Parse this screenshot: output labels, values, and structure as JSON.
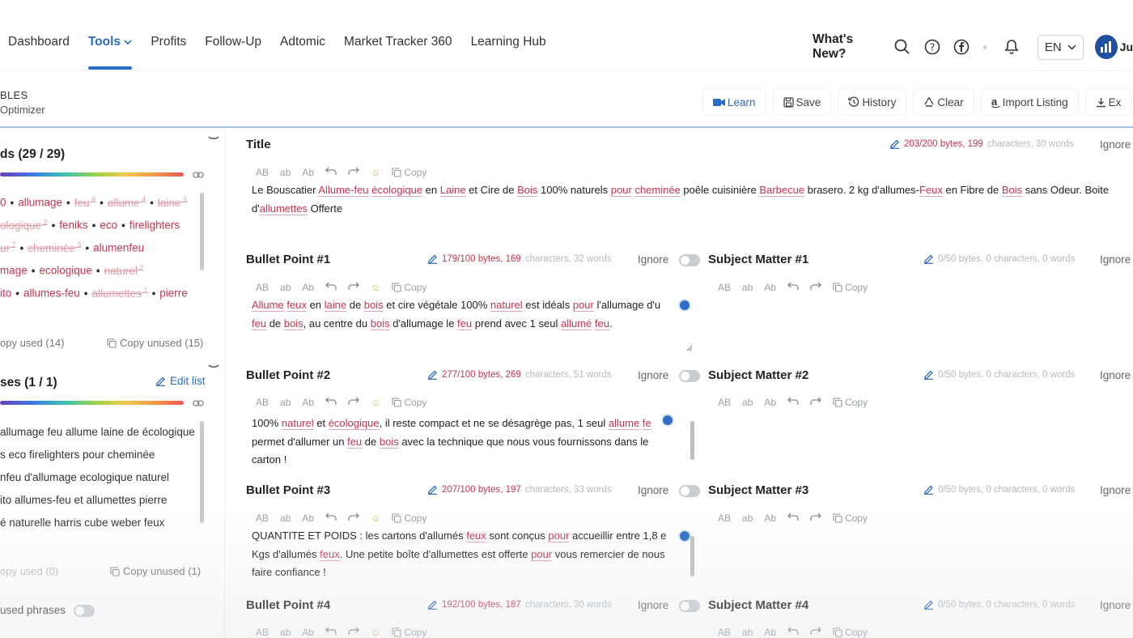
{
  "nav": {
    "links": [
      "Dashboard",
      "Tools",
      "Profits",
      "Follow-Up",
      "Adtomic",
      "Market Tracker 360",
      "Learning Hub"
    ],
    "active": "Tools",
    "whats_new": "What's New?",
    "language": "EN",
    "user_initials": "Ju"
  },
  "breadcrumb": {
    "line1": "BLES",
    "line2": "Optimizer"
  },
  "toolbar": {
    "learn": "Learn",
    "save": "Save",
    "history": "History",
    "clear": "Clear",
    "import": "Import Listing",
    "export": "Ex"
  },
  "keywords": {
    "title": "ds (29 / 29)",
    "lines": [
      [
        {
          "t": "0",
          "s": false,
          "sup": ""
        },
        {
          "t": "allumage",
          "s": false,
          "sup": ""
        },
        {
          "t": "feu",
          "s": true,
          "sup": "8"
        },
        {
          "t": "allume",
          "s": true,
          "sup": "4"
        },
        {
          "t": "laine",
          "s": true,
          "sup": "3"
        }
      ],
      [
        {
          "t": "ologique",
          "s": true,
          "sup": "2"
        },
        {
          "t": "feniks",
          "s": false,
          "sup": ""
        },
        {
          "t": "eco",
          "s": false,
          "sup": ""
        },
        {
          "t": "firelighters",
          "s": false,
          "sup": ""
        }
      ],
      [
        {
          "t": "ur",
          "s": true,
          "sup": "7"
        },
        {
          "t": "cheminée",
          "s": true,
          "sup": "3"
        },
        {
          "t": "alumenfeu",
          "s": false,
          "sup": ""
        }
      ],
      [
        {
          "t": "mage",
          "s": false,
          "sup": ""
        },
        {
          "t": "ecologique",
          "s": false,
          "sup": ""
        },
        {
          "t": "naturel",
          "s": true,
          "sup": "2"
        }
      ],
      [
        {
          "t": "ito",
          "s": false,
          "sup": ""
        },
        {
          "t": "allumes-feu",
          "s": false,
          "sup": ""
        },
        {
          "t": "allumettes",
          "s": true,
          "sup": "1"
        },
        {
          "t": "pierre",
          "s": false,
          "sup": ""
        }
      ]
    ],
    "copy_used": "opy used (14)",
    "copy_unused": "Copy unused (15)"
  },
  "phrases": {
    "title": "ses (1 / 1)",
    "edit_list": "Edit list",
    "items": [
      "allumage feu allume laine de écologique",
      "s eco firelighters pour cheminée",
      "nfeu d'allumage ecologique naturel",
      "ito allumes-feu et allumettes pierre",
      "é naturelle harris cube weber feux"
    ],
    "copy_used": "opy used (0)",
    "copy_unused": "Copy unused (1)",
    "unused_label": "used phrases"
  },
  "editor_tools": {
    "ab_upper": "AB",
    "ab_lower": "ab",
    "ab_title": "Ab",
    "copy": "Copy"
  },
  "ignore_label": "Ignore",
  "sections": {
    "title": {
      "name": "Title",
      "bytes": "203/200 bytes, 199",
      "rest": "characters, 30 words",
      "line1": [
        [
          "Le Bouscatier ",
          false
        ],
        [
          "Allume-feu",
          true
        ],
        [
          " ",
          false
        ],
        [
          "écologique",
          true
        ],
        [
          " en ",
          false
        ],
        [
          "Laine",
          true
        ],
        [
          " et Cire de ",
          false
        ],
        [
          "Bois",
          true
        ],
        [
          " 100% naturels ",
          false
        ],
        [
          "pour",
          true
        ],
        [
          " ",
          false
        ],
        [
          "cheminée",
          true
        ],
        [
          " poêle cuisinière ",
          false
        ],
        [
          "Barbecue",
          true
        ],
        [
          " brasero. 2 kg d'allumes-",
          false
        ],
        [
          "Feux",
          true
        ],
        [
          " en Fibre de ",
          false
        ],
        [
          "Bois",
          true
        ],
        [
          " sans Odeur. Boite",
          false
        ]
      ],
      "line2": [
        [
          "d'",
          false
        ],
        [
          "allumettes",
          true
        ],
        [
          " Offerte",
          false
        ]
      ]
    },
    "bp1": {
      "name": "Bullet Point #1",
      "bytes": "179/100 bytes, 169",
      "rest": "characters, 32 words",
      "line1": [
        [
          "Allume",
          true
        ],
        [
          " ",
          false
        ],
        [
          "feux",
          true
        ],
        [
          " en ",
          false
        ],
        [
          "laine",
          true
        ],
        [
          " de ",
          false
        ],
        [
          "bois",
          true
        ],
        [
          " et cire végétale 100% ",
          false
        ],
        [
          "naturel",
          true
        ],
        [
          " est idéals ",
          false
        ],
        [
          "pour",
          true
        ],
        [
          " l'allumage d'u",
          false
        ]
      ],
      "line2": [
        [
          "feu",
          true
        ],
        [
          " de ",
          false
        ],
        [
          "bois",
          true
        ],
        [
          ", au centre du ",
          false
        ],
        [
          "bois",
          true
        ],
        [
          " d'allumage le ",
          false
        ],
        [
          "feu",
          true
        ],
        [
          " prend avec 1 seul ",
          false
        ],
        [
          "allumé",
          true
        ],
        [
          " ",
          false
        ],
        [
          "feu",
          true
        ],
        [
          ".",
          false
        ]
      ]
    },
    "bp2": {
      "name": "Bullet Point #2",
      "bytes": "277/100 bytes, 269",
      "rest": "characters, 51 words",
      "line1": [
        [
          "100% ",
          false
        ],
        [
          "naturel",
          true
        ],
        [
          " et ",
          false
        ],
        [
          "écologique",
          true
        ],
        [
          ", il reste compact et ne se désagrège pas, 1 seul ",
          false
        ],
        [
          "allume",
          true
        ],
        [
          " ",
          false
        ],
        [
          "fe",
          true
        ]
      ],
      "line2": [
        [
          "permet d'allumer un ",
          false
        ],
        [
          "feu",
          true
        ],
        [
          " de ",
          false
        ],
        [
          "bois",
          true
        ],
        [
          " avec la technique que nous vous fournissons dans le",
          false
        ]
      ],
      "line3": [
        [
          "carton !",
          false
        ]
      ]
    },
    "bp3": {
      "name": "Bullet Point #3",
      "bytes": "207/100 bytes, 197",
      "rest": "characters, 33 words",
      "line1": [
        [
          "QUANTITE ET POIDS : les cartons d'allumés ",
          false
        ],
        [
          "feux",
          true
        ],
        [
          " sont conçus ",
          false
        ],
        [
          "pour",
          true
        ],
        [
          " accueillir entre 1,8 e",
          false
        ]
      ],
      "line2": [
        [
          "Kgs d'allumés ",
          false
        ],
        [
          "feux",
          true
        ],
        [
          ". Une petite boîte d'allumettes est offerte ",
          false
        ],
        [
          "pour",
          true
        ],
        [
          " vous remercier de nous",
          false
        ]
      ],
      "line3": [
        [
          "faire confiance !",
          false
        ]
      ]
    },
    "bp4": {
      "name": "Bullet Point #4",
      "bytes": "192/100 bytes, 187",
      "rest": "characters, 30 words"
    },
    "sm1": {
      "name": "Subject Matter #1",
      "meta": "0/50 bytes, 0 characters, 0 words"
    },
    "sm2": {
      "name": "Subject Matter #2",
      "meta": "0/50 bytes, 0 characters, 0 words"
    },
    "sm3": {
      "name": "Subject Matter #3",
      "meta": "0/50 bytes, 0 characters, 0 words"
    },
    "sm4": {
      "name": "Subject Matter #4",
      "meta": "0/50 bytes, 0 characters, 0 words"
    }
  },
  "colors": {
    "accent": "#2b6cc4",
    "keyword": "#c7354f",
    "keyword_used": "#e59aa8"
  }
}
